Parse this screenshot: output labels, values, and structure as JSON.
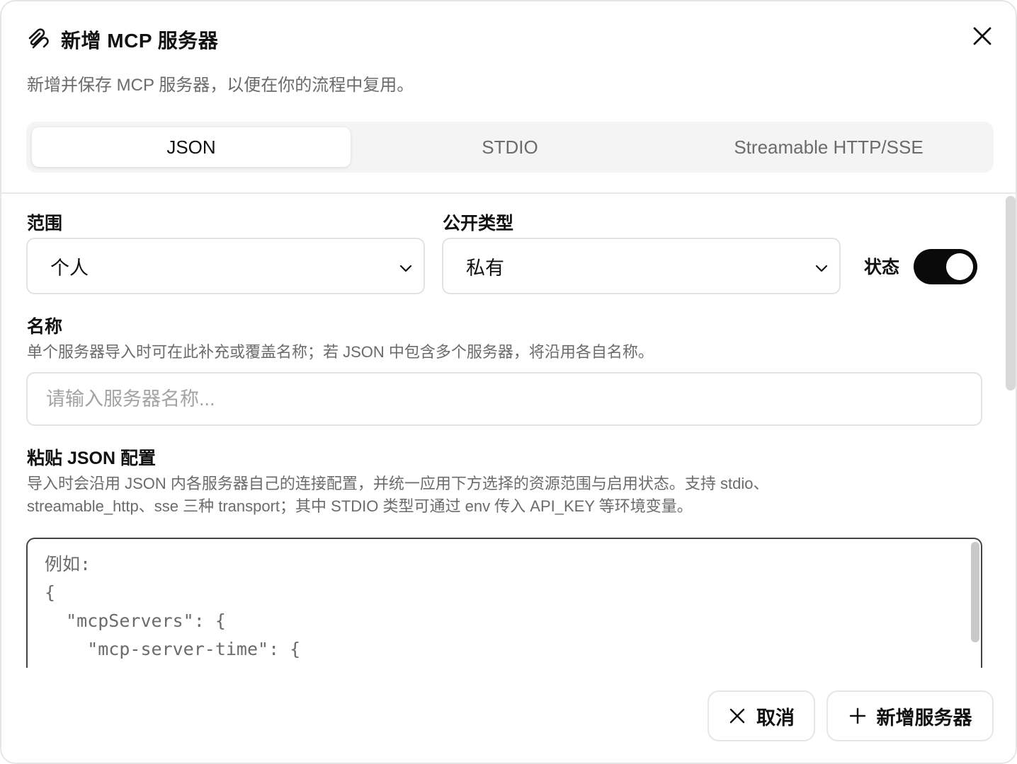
{
  "header": {
    "title": "新增 MCP 服务器",
    "icon": "paperclip-icon",
    "close_icon": "close-icon"
  },
  "description": "新增并保存 MCP 服务器，以便在你的流程中复用。",
  "tabs": [
    {
      "label": "JSON",
      "active": true
    },
    {
      "label": "STDIO",
      "active": false
    },
    {
      "label": "Streamable HTTP/SSE",
      "active": false
    }
  ],
  "form": {
    "scope": {
      "label": "范围",
      "value": "个人"
    },
    "visibility": {
      "label": "公开类型",
      "value": "私有"
    },
    "status": {
      "label": "状态",
      "enabled": true
    },
    "name": {
      "label": "名称",
      "hint": "单个服务器导入时可在此补充或覆盖名称；若 JSON 中包含多个服务器，将沿用各自名称。",
      "placeholder": "请输入服务器名称...",
      "value": ""
    },
    "json_config": {
      "label": "粘贴 JSON 配置",
      "hint_line1": "导入时会沿用 JSON 内各服务器自己的连接配置，并统一应用下方选择的资源范围与启用状态。支持 stdio、",
      "hint_line2": "streamable_http、sse 三种 transport；其中 STDIO 类型可通过 env 传入 API_KEY 等环境变量。",
      "placeholder_lines": [
        "例如:",
        "{",
        "  \"mcpServers\": {",
        "    \"mcp-server-time\": {"
      ]
    }
  },
  "footer": {
    "cancel_label": "取消",
    "submit_label": "新增服务器"
  },
  "colors": {
    "toggle_on": "#0a0a0a",
    "border": "#e2e2e2",
    "muted_text": "#6b6b6b"
  }
}
